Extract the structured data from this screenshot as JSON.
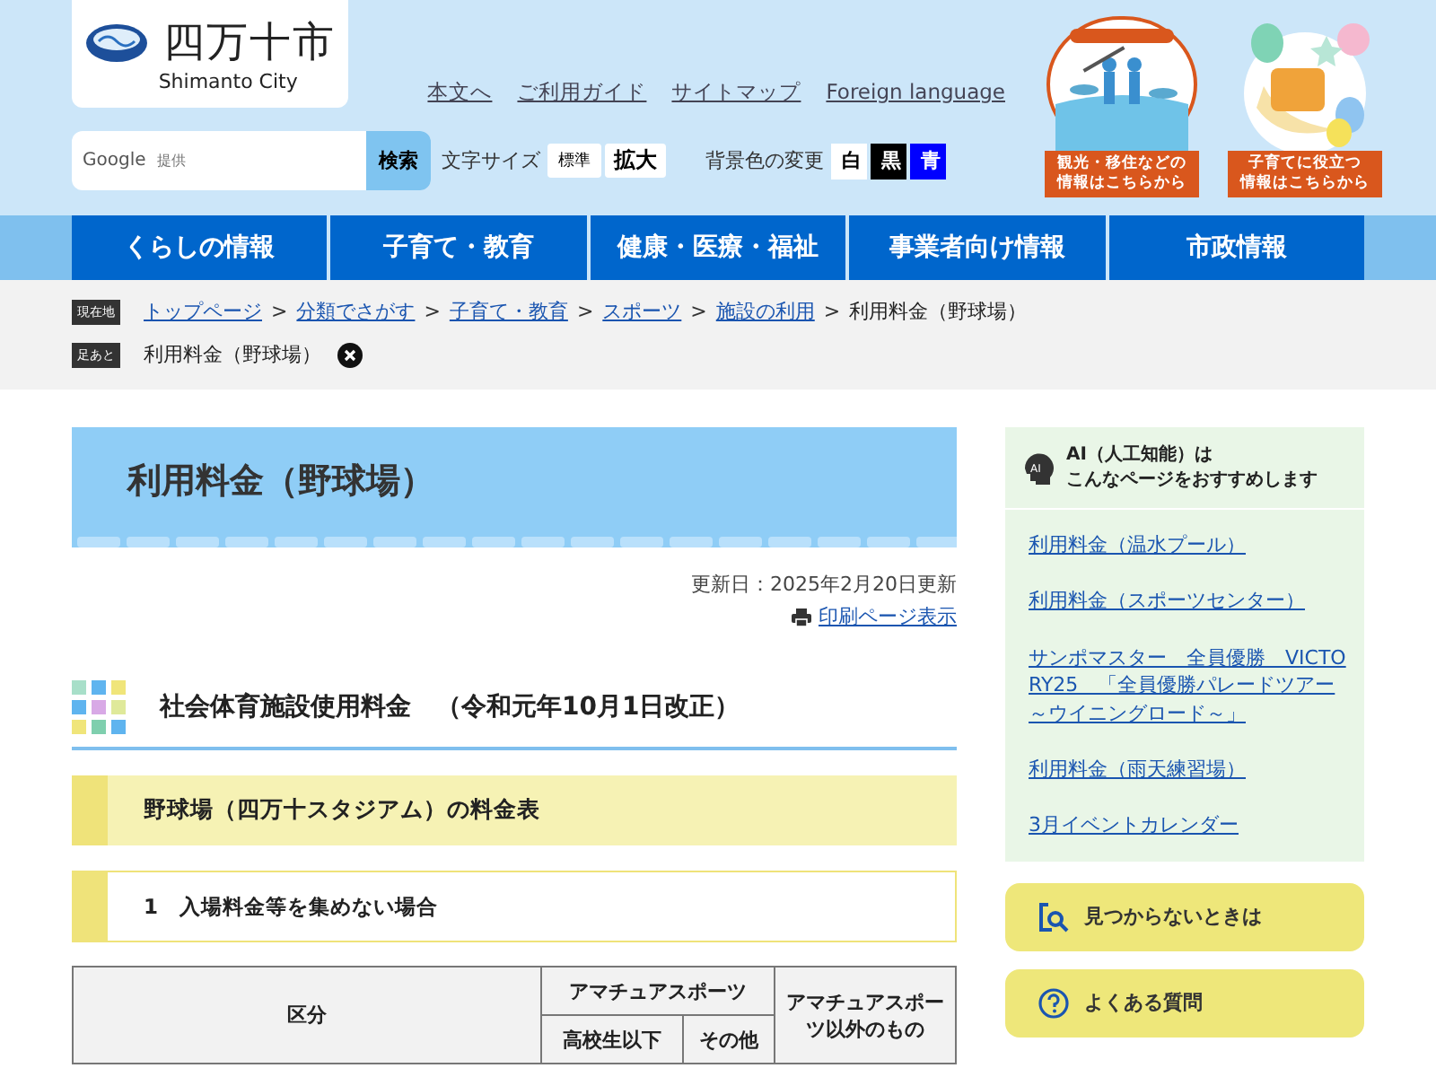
{
  "header": {
    "logo": {
      "name": "四万十市",
      "sub": "Shimanto City"
    },
    "links": [
      "本文へ",
      "ご利用ガイド",
      "サイトマップ",
      "Foreign language"
    ],
    "search": {
      "placeholder_brand": "Google",
      "placeholder": "提供",
      "button": "検索"
    },
    "text_size": {
      "label": "文字サイズ",
      "options": [
        {
          "label": "標準",
          "selected": false
        },
        {
          "label": "拡大",
          "selected": true
        }
      ]
    },
    "bg_color": {
      "label": "背景色の変更",
      "options": [
        {
          "label": "白",
          "color": "#ffffff"
        },
        {
          "label": "黒",
          "color": "#000000"
        },
        {
          "label": "青",
          "color": "#0000ff"
        }
      ]
    },
    "banners": [
      {
        "kind": "picture",
        "caption": [
          "観光・移住などの",
          "情報はこちらから"
        ]
      },
      {
        "kind": "picture",
        "caption": [
          "子育てに役立つ",
          "情報はこちらから"
        ]
      }
    ]
  },
  "nav": [
    "くらしの情報",
    "子育て・教育",
    "健康・医療・福祉",
    "事業者向け情報",
    "市政情報"
  ],
  "breadcrumb": {
    "label": "現在地",
    "separator": ">",
    "items": [
      {
        "text": "トップページ",
        "link": true
      },
      {
        "text": "分類でさがす",
        "link": true
      },
      {
        "text": "子育て・教育",
        "link": true
      },
      {
        "text": "スポーツ",
        "link": true
      },
      {
        "text": "施設の利用",
        "link": true
      },
      {
        "text": "利用料金（野球場）",
        "link": false
      }
    ]
  },
  "footprint": {
    "label": "足あと",
    "items": [
      "利用料金（野球場）"
    ]
  },
  "page": {
    "title": "利用料金（野球場）",
    "updated": "更新日：2025年2月20日更新",
    "print": "印刷ページ表示",
    "h2": "社会体育施設使用料金　（令和元年10月1日改正）",
    "h3": "野球場（四万十スタジアム）の料金表",
    "h4": "1　入場料金等を集めない場合",
    "table": {
      "columns": [
        {
          "text": "区分"
        },
        {
          "text": "アマチュアスポーツ",
          "children": [
            "高校生以下",
            "その他"
          ]
        },
        {
          "text": "アマチュアスポーツ以外のもの"
        }
      ]
    }
  },
  "sidebar": {
    "ai_icon": "AI",
    "ai_title": [
      "AI（人工知能）は",
      "こんなページをおすすめします"
    ],
    "links": [
      "利用料金（温水プール）",
      "利用料金（スポーツセンター）",
      "サンポマスター　全員優勝　VICTORY25　「全員優勝パレードツアー～ウイニングロード～」",
      "利用料金（雨天練習場）",
      "3月イベントカレンダー"
    ],
    "buttons": [
      {
        "kind": "search",
        "label": "見つからないときは"
      },
      {
        "kind": "faq",
        "label": "よくある質問"
      }
    ]
  }
}
